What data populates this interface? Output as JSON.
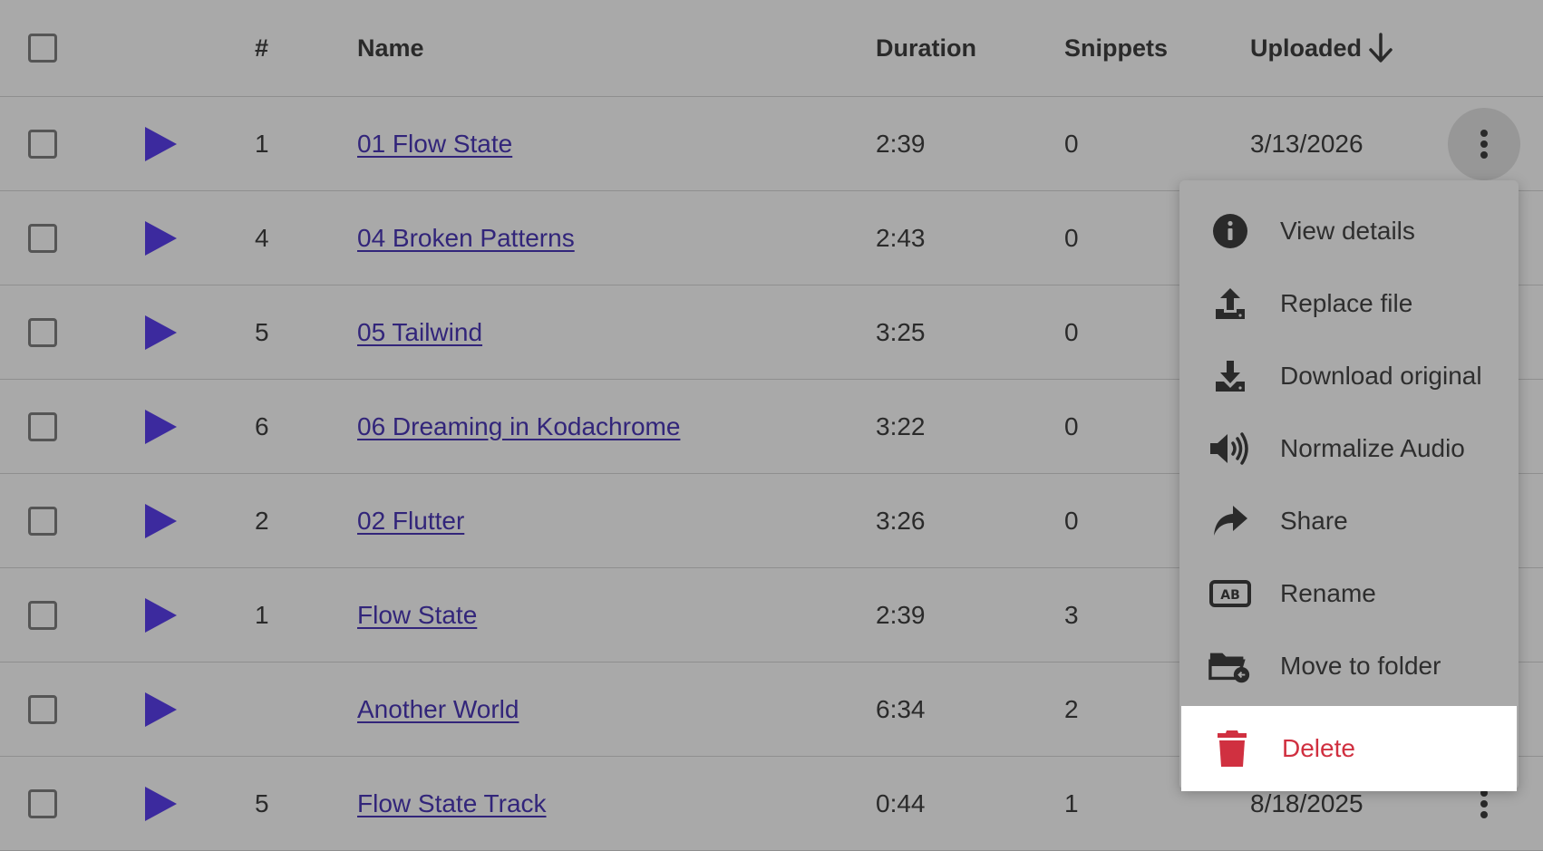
{
  "header": {
    "num_label": "#",
    "name_label": "Name",
    "duration_label": "Duration",
    "snippets_label": "Snippets",
    "uploaded_label": "Uploaded"
  },
  "rows": [
    {
      "num": "1",
      "name": "01 Flow State",
      "duration": "2:39",
      "snippets": "0",
      "uploaded": "3/13/2026"
    },
    {
      "num": "4",
      "name": "04 Broken Patterns",
      "duration": "2:43",
      "snippets": "0",
      "uploaded": ""
    },
    {
      "num": "5",
      "name": "05 Tailwind",
      "duration": "3:25",
      "snippets": "0",
      "uploaded": ""
    },
    {
      "num": "6",
      "name": "06 Dreaming in Kodachrome",
      "duration": "3:22",
      "snippets": "0",
      "uploaded": ""
    },
    {
      "num": "2",
      "name": "02 Flutter",
      "duration": "3:26",
      "snippets": "0",
      "uploaded": ""
    },
    {
      "num": "1",
      "name": "Flow State",
      "duration": "2:39",
      "snippets": "3",
      "uploaded": ""
    },
    {
      "num": "",
      "name": "Another World",
      "duration": "6:34",
      "snippets": "2",
      "uploaded": ""
    },
    {
      "num": "5",
      "name": "Flow State Track",
      "duration": "0:44",
      "snippets": "1",
      "uploaded": "8/18/2025"
    }
  ],
  "menu": {
    "view_details": "View details",
    "replace_file": "Replace file",
    "download_original": "Download original",
    "normalize_audio": "Normalize Audio",
    "share": "Share",
    "rename": "Rename",
    "move_to_folder": "Move to folder",
    "delete": "Delete"
  },
  "icons": {
    "play": "play-icon",
    "more": "more-vert-icon",
    "sort": "arrow-down-icon",
    "view_details": "info-icon",
    "replace_file": "upload-icon",
    "download_original": "download-icon",
    "normalize_audio": "volume-icon",
    "share": "share-icon",
    "rename": "rename-icon",
    "move_to_folder": "folder-move-icon",
    "delete": "trash-icon"
  },
  "colors": {
    "overlay_bg": "#a9a9a9",
    "link": "#32257a",
    "play": "#3c2a9e",
    "delete": "#d03040"
  }
}
